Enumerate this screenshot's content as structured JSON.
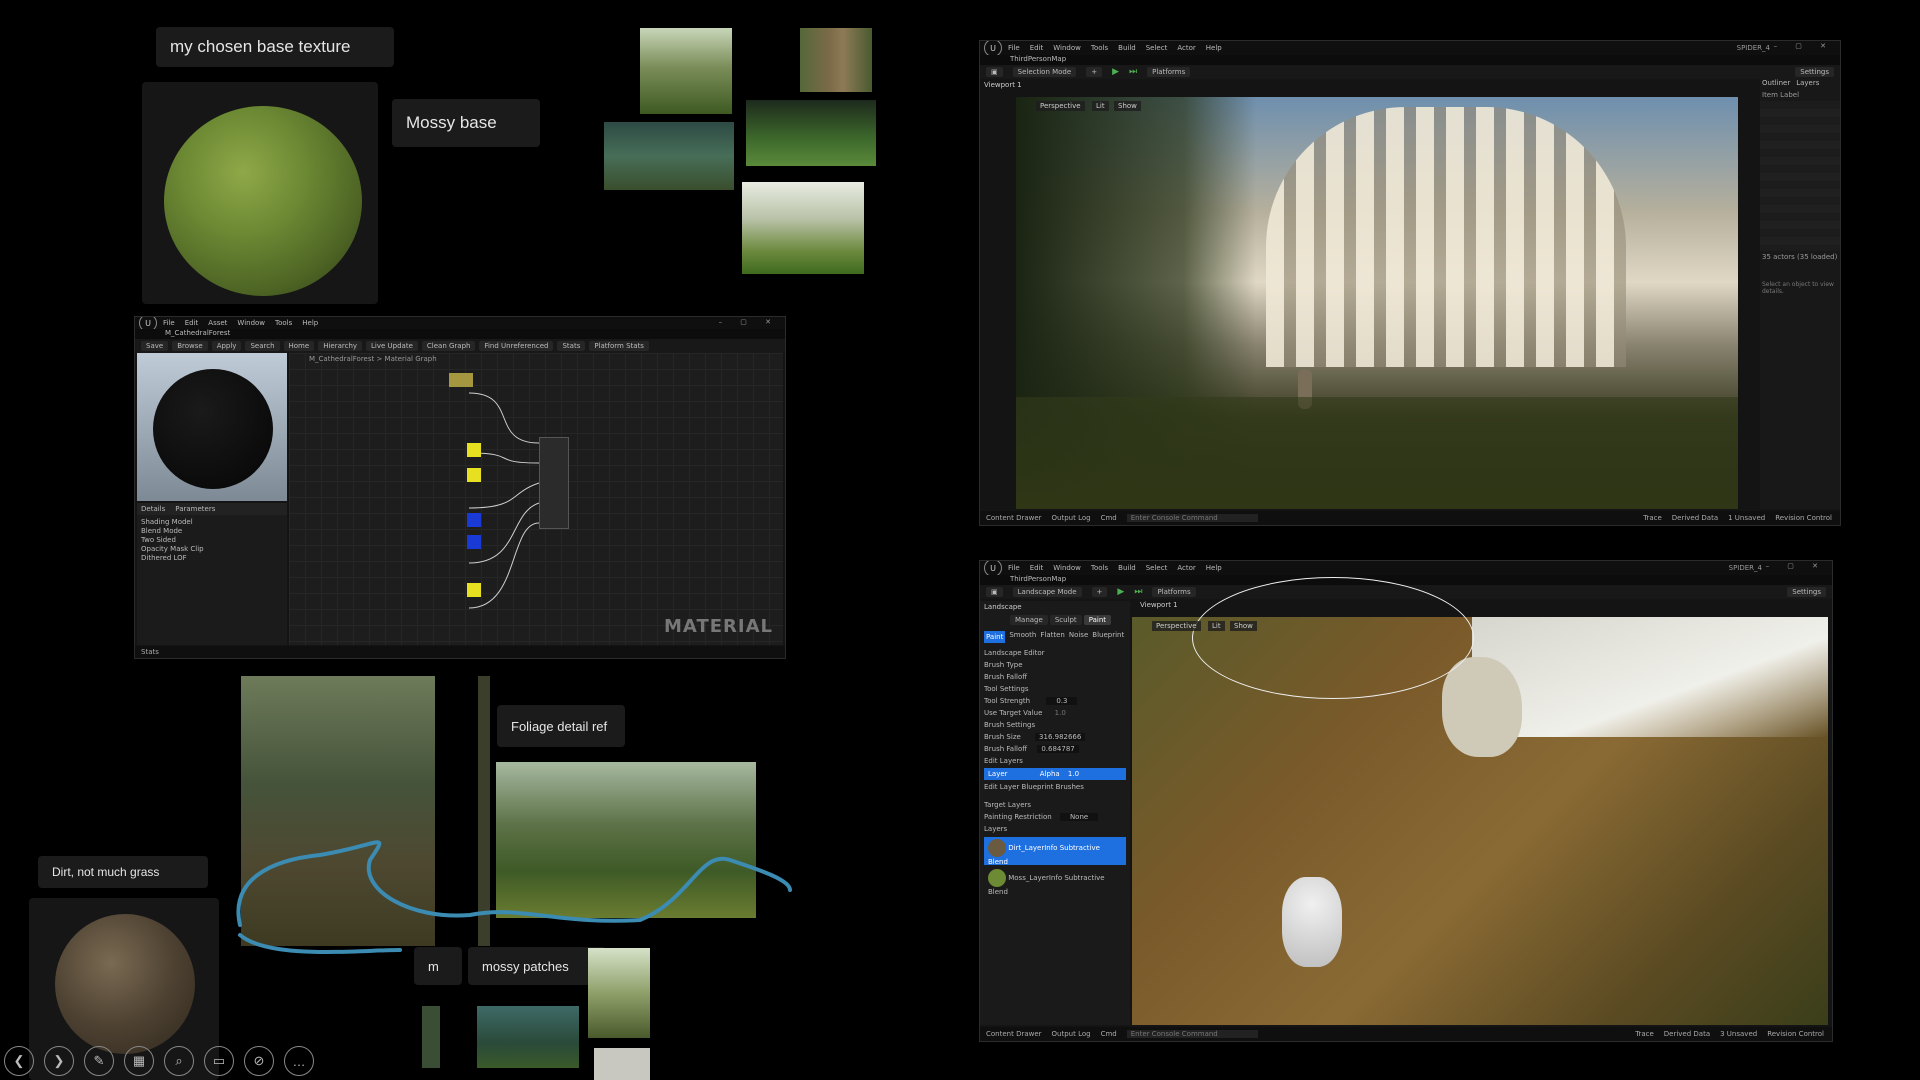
{
  "notes": {
    "base_texture": "my chosen base texture",
    "mossy_base": "Mossy base",
    "foliage_ref": "Foliage detail ref",
    "dirt": "Dirt, not much grass",
    "mossy_patches": "mossy patches",
    "partial": "m"
  },
  "material_editor": {
    "tab": "M_CathedralForest",
    "breadcrumb": "M_CathedralForest  >  Material Graph",
    "watermark": "MATERIAL",
    "menu": [
      "File",
      "Edit",
      "Asset",
      "Window",
      "Tools",
      "Help"
    ],
    "toolbar": [
      "Save",
      "Browse",
      "Apply",
      "Search",
      "Home",
      "Hierarchy",
      "Live Update",
      "Clean Graph",
      "Find Unreferenced",
      "Stats",
      "Platform Stats"
    ],
    "details_rows": [
      "Shading Model",
      "Blend Mode",
      "Two Sided",
      "Opacity Mask Clip",
      "Dithered LOF"
    ],
    "panels": [
      "Details",
      "Parameters"
    ],
    "palette_tab": "Stats"
  },
  "ue_top": {
    "menu": [
      "File",
      "Edit",
      "Window",
      "Tools",
      "Build",
      "Select",
      "Actor",
      "Help"
    ],
    "project": "SPIDER_4",
    "map": "ThirdPersonMap",
    "mode": "Selection Mode",
    "platforms": "Platforms",
    "settings": "Settings",
    "viewport_tab": "Viewport 1",
    "view_mode": "Perspective",
    "lit": "Lit",
    "show": "Show",
    "outliner_tab": "Outliner",
    "layers_tab": "Layers",
    "outliner_filter": "Item Label",
    "actors_count": "35 actors (35 loaded)",
    "details_hint": "Select an object to view details.",
    "status": [
      "Content Drawer",
      "Output Log",
      "Cmd"
    ],
    "cmd_placeholder": "Enter Console Command",
    "status_right": [
      "Trace",
      "Derived Data",
      "1 Unsaved",
      "Revision Control"
    ]
  },
  "ue_bottom": {
    "menu": [
      "File",
      "Edit",
      "Window",
      "Tools",
      "Build",
      "Select",
      "Actor",
      "Help"
    ],
    "project": "SPIDER_4",
    "map": "ThirdPersonMap",
    "mode": "Landscape Mode",
    "platforms": "Platforms",
    "settings": "Settings",
    "panel_tab": "Landscape",
    "viewport_tab": "Viewport 1",
    "mode_tabs": [
      "Manage",
      "Sculpt",
      "Paint"
    ],
    "tools": [
      "Paint",
      "Smooth",
      "Flatten",
      "Noise",
      "Blueprint"
    ],
    "sections": [
      "Landscape Editor",
      "Tool Settings",
      "Brush Settings",
      "Edit Layers",
      "Edit Layer Blueprint Brushes",
      "Target Layers"
    ],
    "brush_type": "Brush Type",
    "brush_falloff": "Brush Falloff",
    "tool_strength_label": "Tool Strength",
    "tool_strength": "0.3",
    "use_target_label": "Use Target Value",
    "use_target": "1.0",
    "brush_size_label": "Brush Size",
    "brush_size": "316.982666",
    "brush_falloff_label": "Brush Falloff",
    "brush_falloff_val": "0.684787",
    "layer_name": "Layer",
    "layer_alpha": "Alpha",
    "layer_alpha_val": "1.0",
    "painting_restriction": "Painting Restriction",
    "painting_value": "None",
    "layers_label": "Layers",
    "layer_dirt": "Dirt_LayerInfo",
    "layer_moss": "Moss_LayerInfo",
    "blend": "Subtractive Blend",
    "view_mode": "Perspective",
    "lit": "Lit",
    "show": "Show",
    "status": [
      "Content Drawer",
      "Output Log",
      "Cmd"
    ],
    "cmd_placeholder": "Enter Console Command",
    "status_right": [
      "Trace",
      "Derived Data",
      "3 Unsaved",
      "Revision Control"
    ]
  },
  "dock": [
    {
      "icon": "back-icon",
      "glyph": "❮"
    },
    {
      "icon": "forward-icon",
      "glyph": "❯"
    },
    {
      "icon": "pen-icon",
      "glyph": "✎"
    },
    {
      "icon": "grid-icon",
      "glyph": "▦"
    },
    {
      "icon": "zoom-icon",
      "glyph": "⌕"
    },
    {
      "icon": "caption-icon",
      "glyph": "▭"
    },
    {
      "icon": "no-camera-icon",
      "glyph": "⊘"
    },
    {
      "icon": "more-icon",
      "glyph": "…"
    }
  ]
}
